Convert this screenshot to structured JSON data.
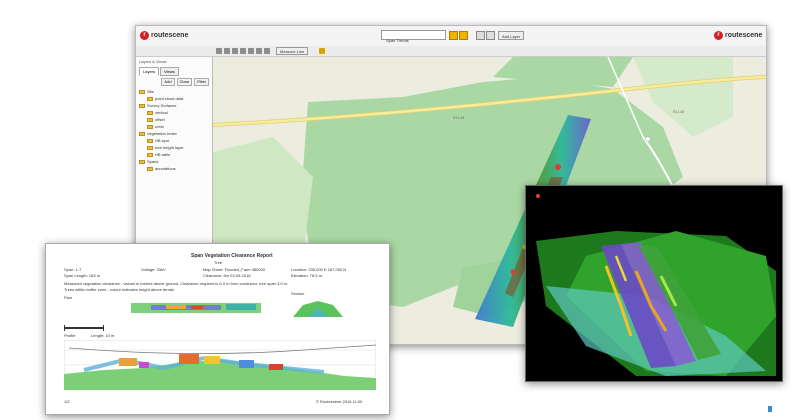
{
  "app": {
    "brand_left": "routescene",
    "brand_right": "routescene",
    "logo_mark": "r",
    "search_placeholder": "",
    "layer_select_label": "Span Trends",
    "add_button_label": "Add Layer",
    "toolbar_measure_label": "Measure Line",
    "sidebar": {
      "title": "Layers & Views",
      "tabs": [
        "Layers",
        "Views"
      ],
      "buttons": [
        "Add",
        "Clear",
        "Filter"
      ],
      "tree": [
        {
          "label": "Site",
          "level": 0
        },
        {
          "label": "point cloud data",
          "level": 1
        },
        {
          "label": "Survey Surfaces",
          "level": 0
        },
        {
          "label": "vertical",
          "level": 1
        },
        {
          "label": "offset",
          "level": 1
        },
        {
          "label": "crest",
          "level": 1
        },
        {
          "label": "Vegetation Index",
          "level": 0
        },
        {
          "label": "HB spot",
          "level": 1
        },
        {
          "label": "tree height layer",
          "level": 1
        },
        {
          "label": "HB table",
          "level": 1
        },
        {
          "label": "Spans",
          "level": 0
        },
        {
          "label": "annotations",
          "level": 1
        }
      ]
    },
    "map_labels": [
      "B1145",
      "B1145"
    ],
    "icons": [
      "zoom-in-icon",
      "zoom-out-icon",
      "pan-icon",
      "select-icon",
      "measure-icon",
      "print-icon",
      "layers-icon"
    ]
  },
  "report": {
    "title": "Span Vegetation Clearance Report",
    "subtitle": "Tree",
    "meta_left": [
      "Span: 1-7",
      "Span Length: 183 m"
    ],
    "meta_mid": [
      "Voltage: 33kV",
      ""
    ],
    "meta_right": [
      "Map Sheet: Flooded_Farm 380000",
      "Clearance: 6m 03-05-2016"
    ],
    "meta_far": [
      "Location: 335,000 E 187,000 N",
      "Elevation: 78.5 m"
    ],
    "notes": [
      "Measured vegetation clearance - values in metres above ground. Clearance required is 6.0 m from conductor, tree span 3.0 m.",
      "Trees within buffer zone - colour indicates height above terrain."
    ],
    "plan_label": "Plan",
    "section_label": "Section",
    "profile_label": "Profile",
    "scale_text": "Length: 10 m",
    "footer_left": "1/2",
    "footer_right": "© Routescene 2016 11:00"
  },
  "colors": {
    "brand_red": "#d32027",
    "map_land": "#ececdf",
    "map_forest": "#a8d8a3",
    "road_yellow": "#f5e9a3",
    "cloud_black": "#000000"
  }
}
